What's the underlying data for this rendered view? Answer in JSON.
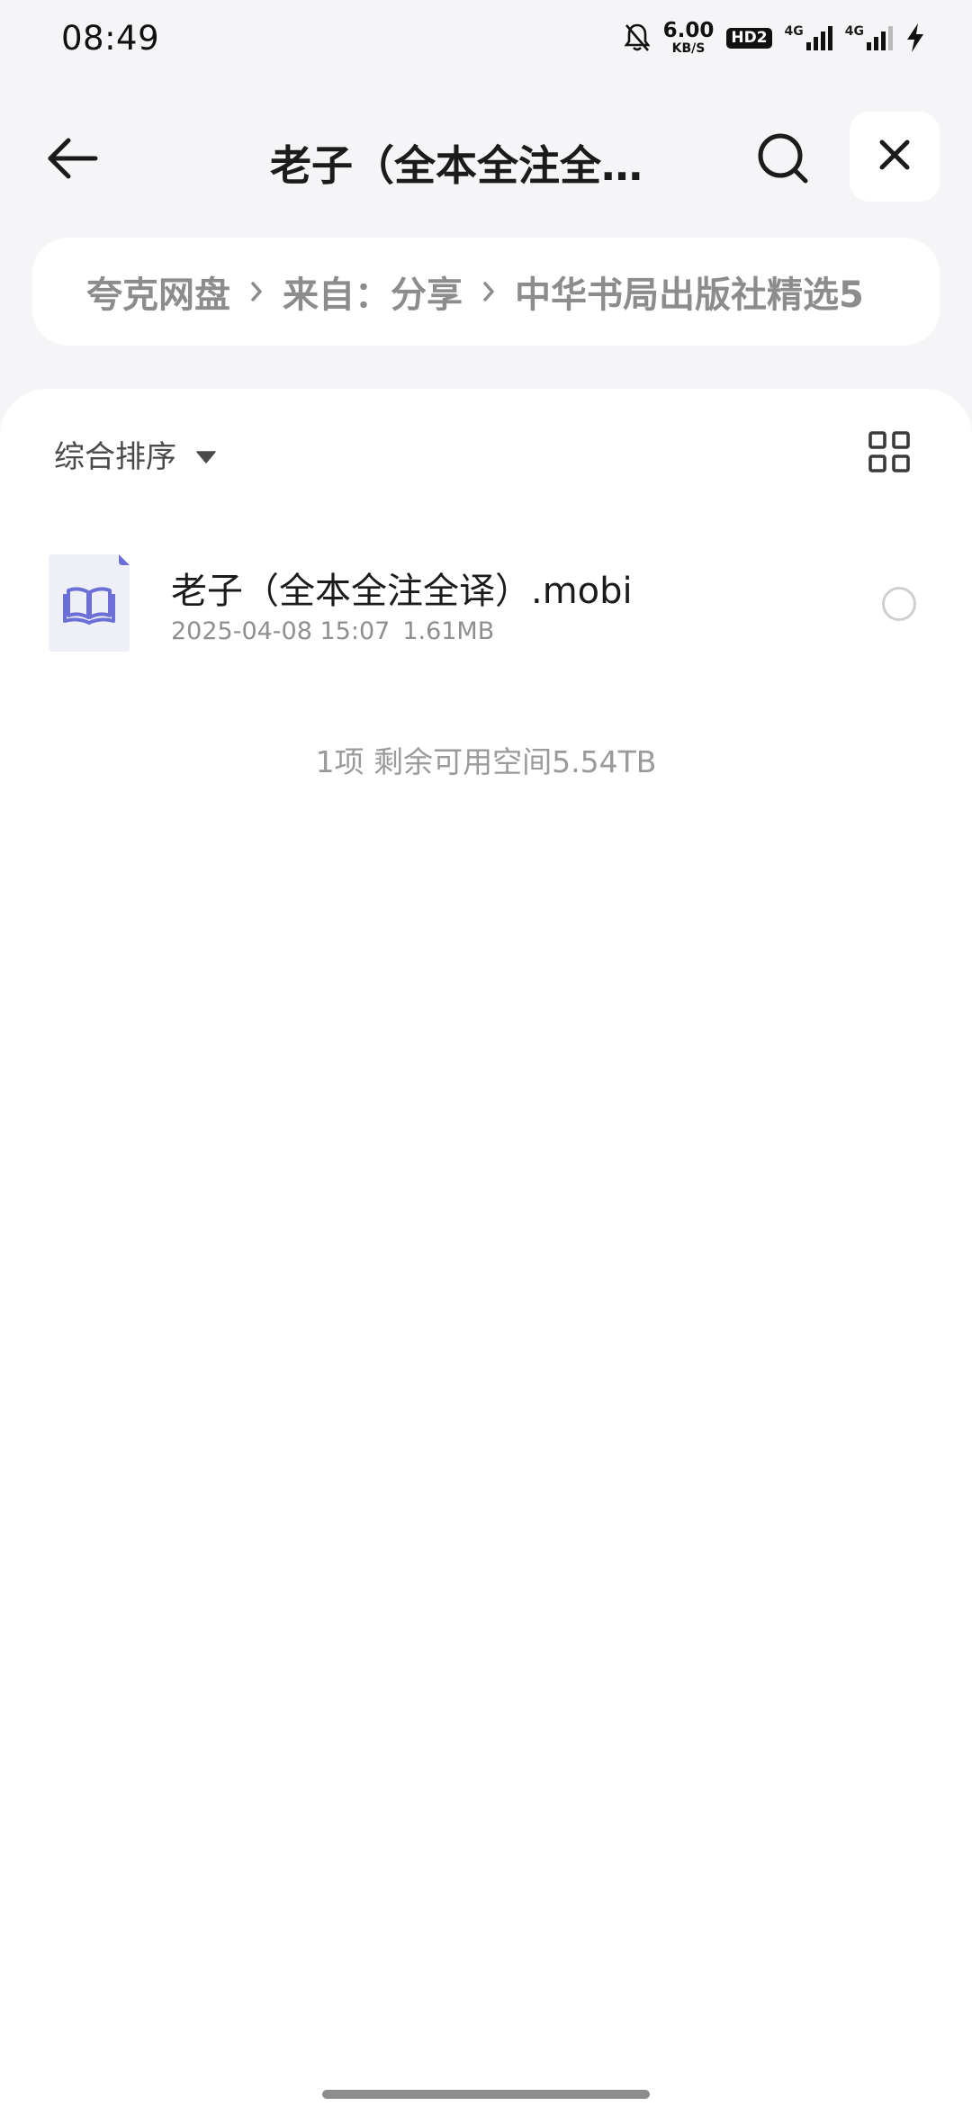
{
  "status_bar": {
    "time": "08:49",
    "net_speed_value": "6.00",
    "net_speed_unit": "KB/S",
    "hd_badge": "HD2",
    "signal1_label": "4G",
    "signal2_label": "4G",
    "icons": [
      "bell-muted-icon",
      "signal-icon",
      "signal-icon",
      "charging-icon"
    ]
  },
  "header": {
    "title": "老子（全本全注全…",
    "icons": [
      "back-arrow-icon",
      "search-icon",
      "close-icon"
    ]
  },
  "breadcrumb": {
    "items": [
      "夸克网盘",
      "来自：分享",
      "中华书局出版社精选5"
    ]
  },
  "toolbar": {
    "sort_label": "综合排序",
    "icons": [
      "caret-down-icon",
      "grid-view-icon"
    ]
  },
  "files": [
    {
      "name": "老子（全本全注全译）.mobi",
      "date": "2025-04-08 15:07",
      "size": "1.61MB",
      "icon": "ebook-file-icon"
    }
  ],
  "footer": {
    "summary": "1项 剩余可用空间5.54TB"
  },
  "colors": {
    "background": "#f5f5f7",
    "panel": "#ffffff",
    "file_icon_accent": "#6b6fd6"
  }
}
